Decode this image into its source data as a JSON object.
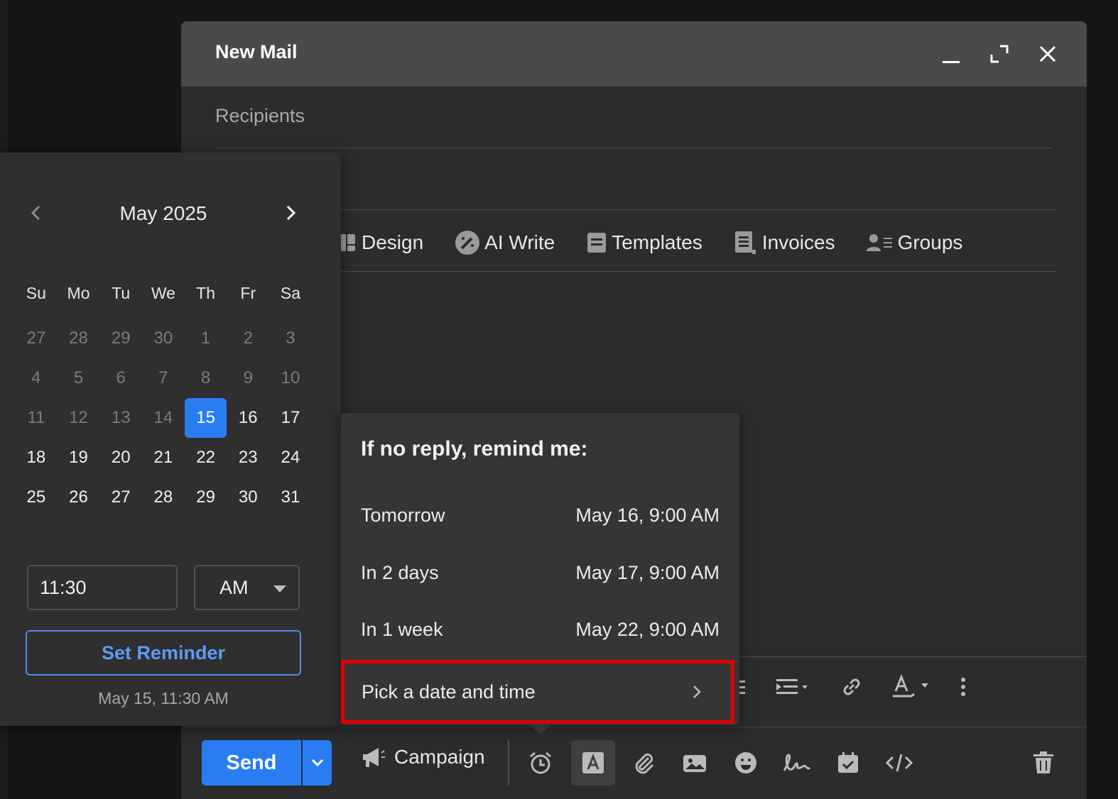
{
  "compose": {
    "title": "New Mail",
    "recipients_placeholder": "Recipients",
    "tools": [
      {
        "label": "Design",
        "icon": "design-icon"
      },
      {
        "label": "AI Write",
        "icon": "ai-write-icon"
      },
      {
        "label": "Templates",
        "icon": "templates-icon"
      },
      {
        "label": "Invoices",
        "icon": "invoices-icon"
      },
      {
        "label": "Groups",
        "icon": "groups-icon"
      }
    ],
    "send_label": "Send",
    "campaign_label": "Campaign"
  },
  "calendar": {
    "month_label": "May 2025",
    "weekdays": [
      "Su",
      "Mo",
      "Tu",
      "We",
      "Th",
      "Fr",
      "Sa"
    ],
    "weeks": [
      [
        "27",
        "28",
        "29",
        "30",
        "1",
        "2",
        "3"
      ],
      [
        "4",
        "5",
        "6",
        "7",
        "8",
        "9",
        "10"
      ],
      [
        "11",
        "12",
        "13",
        "14",
        "15",
        "16",
        "17"
      ],
      [
        "18",
        "19",
        "20",
        "21",
        "22",
        "23",
        "24"
      ],
      [
        "25",
        "26",
        "27",
        "28",
        "29",
        "30",
        "31"
      ]
    ],
    "selected_day": "15",
    "time_value": "11:30",
    "ampm_value": "AM",
    "set_button": "Set Reminder",
    "summary": "May 15, 11:30 AM",
    "accent_color": "#2a7cf3"
  },
  "reminder_menu": {
    "title": "If no reply, remind me:",
    "options": [
      {
        "label": "Tomorrow",
        "when": "May 16, 9:00 AM"
      },
      {
        "label": "In 2 days",
        "when": "May 17, 9:00 AM"
      },
      {
        "label": "In 1 week",
        "when": "May 22, 9:00 AM"
      }
    ],
    "pick_label": "Pick a date and time",
    "highlight_color": "#e00000"
  }
}
